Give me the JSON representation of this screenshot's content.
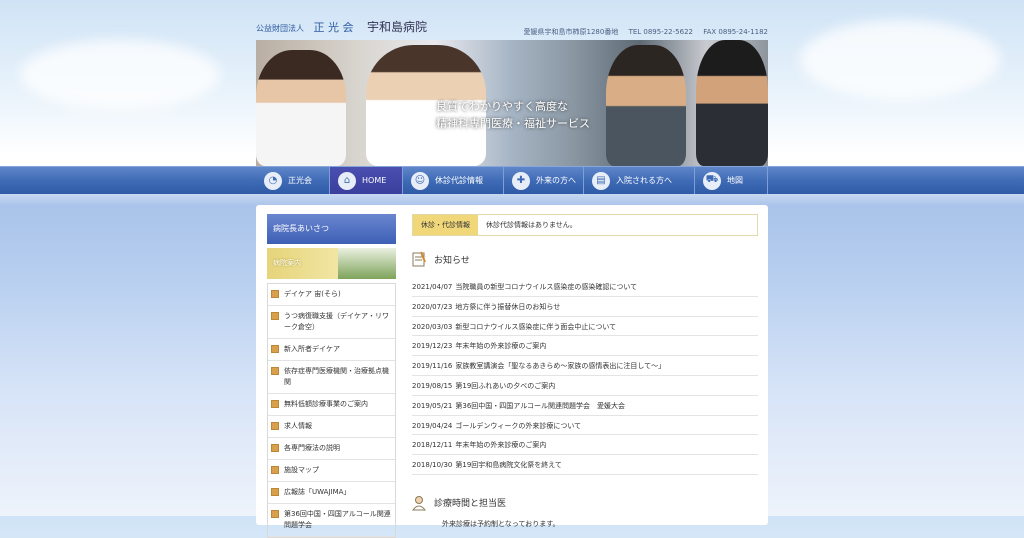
{
  "header": {
    "org_prefix": "公益財団法人",
    "org_name": "正 光 会",
    "hospital": "宇和島病院",
    "address": "愛媛県宇和島市柿原1280番地",
    "tel": "TEL 0895-22-5622",
    "fax": "FAX 0895-24-1182"
  },
  "hero": {
    "line1": "良質でわかりやすく高度な",
    "line2": "精神科専門医療・福祉サービス"
  },
  "nav": {
    "items": [
      {
        "label": "正光会",
        "icon": "logo-icon"
      },
      {
        "label": "HOME",
        "icon": "home-icon"
      },
      {
        "label": "休診代診情報",
        "icon": "doctor-icon"
      },
      {
        "label": "外来の方へ",
        "icon": "outpatient-icon"
      },
      {
        "label": "入院される方へ",
        "icon": "inpatient-icon"
      },
      {
        "label": "地図",
        "icon": "car-icon"
      }
    ]
  },
  "sidebar": {
    "head": "病院長あいさつ",
    "banner": "病院案内",
    "items": [
      "デイケア 宙(そら)",
      "うつ病復職支援（デイケア・リワーク倉空）",
      "新入所者デイケア",
      "依存症専門医療機関・治療拠点機関",
      "無料低額診療事業のご案内",
      "求人情報",
      "各専門療法の説明",
      "施設マップ",
      "広報誌「UWAJIMA」",
      "第36回中国・四国アルコール関連問題学会"
    ]
  },
  "main": {
    "notice_tag": "休診・代診情報",
    "notice_text": "休診代診情報はありません。",
    "news_title": "お知らせ",
    "news": [
      {
        "date": "2021/04/07",
        "text": "当院職員の新型コロナウイルス感染症の感染確認について"
      },
      {
        "date": "2020/07/23",
        "text": "地方祭に伴う振替休日のお知らせ"
      },
      {
        "date": "2020/03/03",
        "text": "新型コロナウイルス感染症に伴う面会中止について"
      },
      {
        "date": "2019/12/23",
        "text": "年末年始の外来診療のご案内"
      },
      {
        "date": "2019/11/16",
        "text": "家族教室講演会「聖なるあきらめ～家族の感情表出に注目して～」"
      },
      {
        "date": "2019/08/15",
        "text": "第19回ふれあいの夕べのご案内"
      },
      {
        "date": "2019/05/21",
        "text": "第36回中国・四国アルコール関連問題学会　愛媛大会"
      },
      {
        "date": "2019/04/24",
        "text": "ゴールデンウィークの外来診療について"
      },
      {
        "date": "2018/12/11",
        "text": "年末年始の外来診療のご案内"
      },
      {
        "date": "2018/10/30",
        "text": "第19回宇和島病院文化祭を終えて"
      }
    ],
    "schedule_title": "診療時間と担当医",
    "schedule_note": "外来診療は予約制となっております。"
  }
}
